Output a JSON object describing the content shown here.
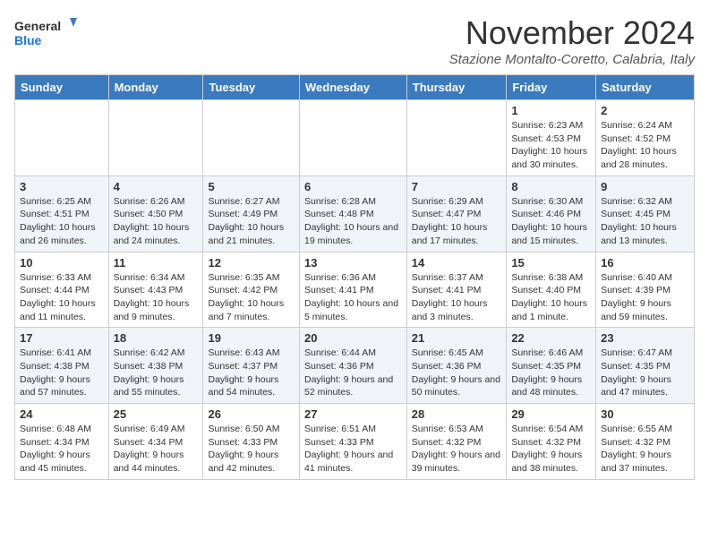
{
  "header": {
    "logo_line1": "General",
    "logo_line2": "Blue",
    "month": "November 2024",
    "location": "Stazione Montalto-Coretto, Calabria, Italy"
  },
  "days_of_week": [
    "Sunday",
    "Monday",
    "Tuesday",
    "Wednesday",
    "Thursday",
    "Friday",
    "Saturday"
  ],
  "weeks": [
    [
      {
        "day": "",
        "info": ""
      },
      {
        "day": "",
        "info": ""
      },
      {
        "day": "",
        "info": ""
      },
      {
        "day": "",
        "info": ""
      },
      {
        "day": "",
        "info": ""
      },
      {
        "day": "1",
        "info": "Sunrise: 6:23 AM\nSunset: 4:53 PM\nDaylight: 10 hours and 30 minutes."
      },
      {
        "day": "2",
        "info": "Sunrise: 6:24 AM\nSunset: 4:52 PM\nDaylight: 10 hours and 28 minutes."
      }
    ],
    [
      {
        "day": "3",
        "info": "Sunrise: 6:25 AM\nSunset: 4:51 PM\nDaylight: 10 hours and 26 minutes."
      },
      {
        "day": "4",
        "info": "Sunrise: 6:26 AM\nSunset: 4:50 PM\nDaylight: 10 hours and 24 minutes."
      },
      {
        "day": "5",
        "info": "Sunrise: 6:27 AM\nSunset: 4:49 PM\nDaylight: 10 hours and 21 minutes."
      },
      {
        "day": "6",
        "info": "Sunrise: 6:28 AM\nSunset: 4:48 PM\nDaylight: 10 hours and 19 minutes."
      },
      {
        "day": "7",
        "info": "Sunrise: 6:29 AM\nSunset: 4:47 PM\nDaylight: 10 hours and 17 minutes."
      },
      {
        "day": "8",
        "info": "Sunrise: 6:30 AM\nSunset: 4:46 PM\nDaylight: 10 hours and 15 minutes."
      },
      {
        "day": "9",
        "info": "Sunrise: 6:32 AM\nSunset: 4:45 PM\nDaylight: 10 hours and 13 minutes."
      }
    ],
    [
      {
        "day": "10",
        "info": "Sunrise: 6:33 AM\nSunset: 4:44 PM\nDaylight: 10 hours and 11 minutes."
      },
      {
        "day": "11",
        "info": "Sunrise: 6:34 AM\nSunset: 4:43 PM\nDaylight: 10 hours and 9 minutes."
      },
      {
        "day": "12",
        "info": "Sunrise: 6:35 AM\nSunset: 4:42 PM\nDaylight: 10 hours and 7 minutes."
      },
      {
        "day": "13",
        "info": "Sunrise: 6:36 AM\nSunset: 4:41 PM\nDaylight: 10 hours and 5 minutes."
      },
      {
        "day": "14",
        "info": "Sunrise: 6:37 AM\nSunset: 4:41 PM\nDaylight: 10 hours and 3 minutes."
      },
      {
        "day": "15",
        "info": "Sunrise: 6:38 AM\nSunset: 4:40 PM\nDaylight: 10 hours and 1 minute."
      },
      {
        "day": "16",
        "info": "Sunrise: 6:40 AM\nSunset: 4:39 PM\nDaylight: 9 hours and 59 minutes."
      }
    ],
    [
      {
        "day": "17",
        "info": "Sunrise: 6:41 AM\nSunset: 4:38 PM\nDaylight: 9 hours and 57 minutes."
      },
      {
        "day": "18",
        "info": "Sunrise: 6:42 AM\nSunset: 4:38 PM\nDaylight: 9 hours and 55 minutes."
      },
      {
        "day": "19",
        "info": "Sunrise: 6:43 AM\nSunset: 4:37 PM\nDaylight: 9 hours and 54 minutes."
      },
      {
        "day": "20",
        "info": "Sunrise: 6:44 AM\nSunset: 4:36 PM\nDaylight: 9 hours and 52 minutes."
      },
      {
        "day": "21",
        "info": "Sunrise: 6:45 AM\nSunset: 4:36 PM\nDaylight: 9 hours and 50 minutes."
      },
      {
        "day": "22",
        "info": "Sunrise: 6:46 AM\nSunset: 4:35 PM\nDaylight: 9 hours and 48 minutes."
      },
      {
        "day": "23",
        "info": "Sunrise: 6:47 AM\nSunset: 4:35 PM\nDaylight: 9 hours and 47 minutes."
      }
    ],
    [
      {
        "day": "24",
        "info": "Sunrise: 6:48 AM\nSunset: 4:34 PM\nDaylight: 9 hours and 45 minutes."
      },
      {
        "day": "25",
        "info": "Sunrise: 6:49 AM\nSunset: 4:34 PM\nDaylight: 9 hours and 44 minutes."
      },
      {
        "day": "26",
        "info": "Sunrise: 6:50 AM\nSunset: 4:33 PM\nDaylight: 9 hours and 42 minutes."
      },
      {
        "day": "27",
        "info": "Sunrise: 6:51 AM\nSunset: 4:33 PM\nDaylight: 9 hours and 41 minutes."
      },
      {
        "day": "28",
        "info": "Sunrise: 6:53 AM\nSunset: 4:32 PM\nDaylight: 9 hours and 39 minutes."
      },
      {
        "day": "29",
        "info": "Sunrise: 6:54 AM\nSunset: 4:32 PM\nDaylight: 9 hours and 38 minutes."
      },
      {
        "day": "30",
        "info": "Sunrise: 6:55 AM\nSunset: 4:32 PM\nDaylight: 9 hours and 37 minutes."
      }
    ]
  ]
}
